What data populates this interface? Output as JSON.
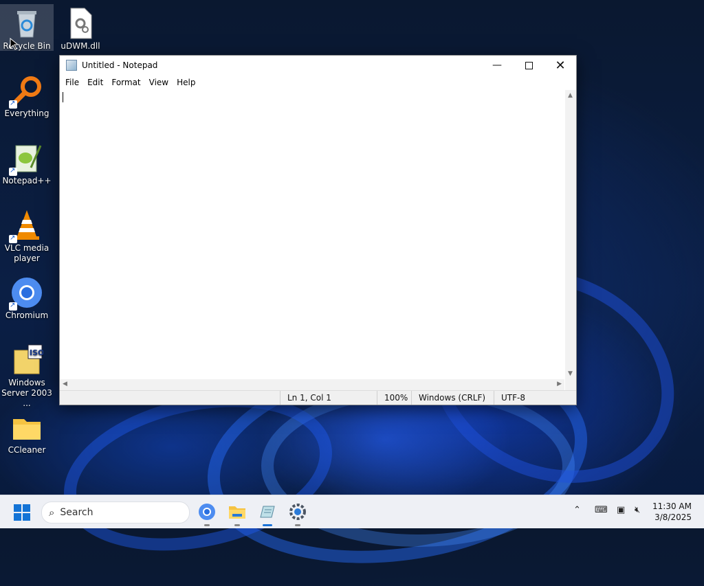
{
  "desktop": {
    "icons": [
      {
        "label": "Recycle Bin",
        "icon": "recycle-bin-icon"
      },
      {
        "label": "uDWM.dll",
        "icon": "dll-file-icon"
      },
      {
        "label": "Everything",
        "icon": "everything-search-icon"
      },
      {
        "label": "Notepad++",
        "icon": "notepad-plus-plus-icon"
      },
      {
        "label": "VLC media player",
        "icon": "vlc-cone-icon"
      },
      {
        "label": "Chromium",
        "icon": "chromium-icon"
      },
      {
        "label": "Windows Server 2003 ...",
        "icon": "iso-file-icon"
      },
      {
        "label": "CCleaner",
        "icon": "folder-icon"
      }
    ]
  },
  "notepad": {
    "title": "Untitled - Notepad",
    "menu": [
      "File",
      "Edit",
      "Format",
      "View",
      "Help"
    ],
    "content": "",
    "status": {
      "position": "Ln 1, Col 1",
      "zoom": "100%",
      "line_ending": "Windows (CRLF)",
      "encoding": "UTF-8"
    }
  },
  "taskbar": {
    "search_placeholder": "Search",
    "apps": [
      "chromium",
      "file-explorer",
      "notepad",
      "settings"
    ],
    "active_app": "notepad",
    "time": "11:30 AM",
    "date": "3/8/2025"
  },
  "colors": {
    "accent": "#1a73d8",
    "taskbar": "#eef0f5"
  }
}
